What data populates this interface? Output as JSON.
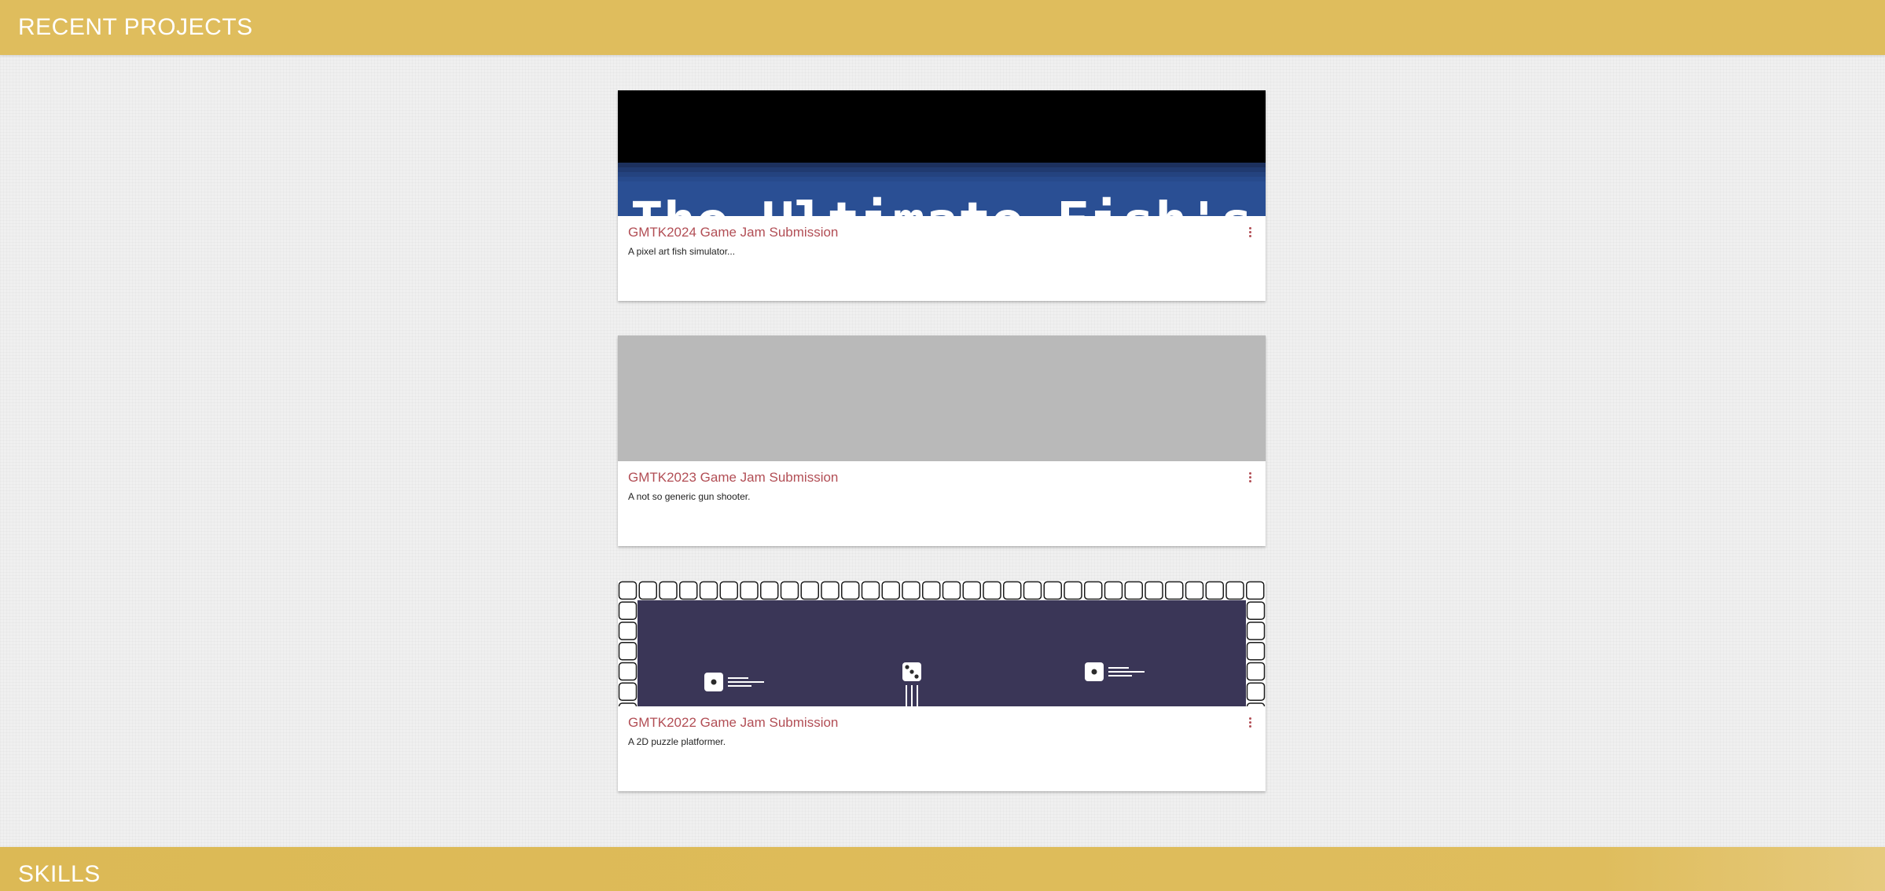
{
  "header": {
    "title": "RECENT PROJECTS"
  },
  "footer": {
    "title": "SKILLS"
  },
  "projects": [
    {
      "title": "GMTK2024 Game Jam Submission",
      "description": "A pixel art fish simulator...",
      "image_text": "The Ultimate Fish's",
      "image_icon": "pixel-title-banner"
    },
    {
      "title": "GMTK2023 Game Jam Submission",
      "description": "A not so generic gun shooter.",
      "image_icon": "image-placeholder"
    },
    {
      "title": "GMTK2022 Game Jam Submission",
      "description": "A 2D puzzle platformer.",
      "image_icon": "dice-platformer-scene"
    }
  ],
  "colors": {
    "bar": "#dfbd5d",
    "title_accent": "#b24e55",
    "puzzle_bg": "#3a3657",
    "fish_banner": "#2a4f94",
    "placeholder": "#b9b9b9"
  }
}
